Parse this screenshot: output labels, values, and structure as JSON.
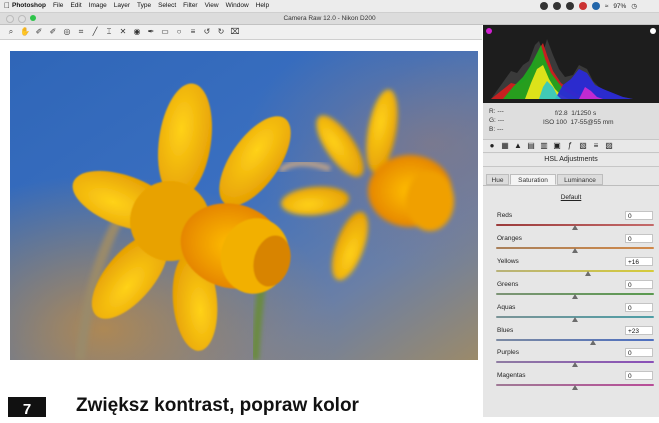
{
  "menubar": {
    "items": [
      "Photoshop",
      "File",
      "Edit",
      "Image",
      "Layer",
      "Type",
      "Select",
      "Filter",
      "View",
      "Window",
      "Help"
    ],
    "battery": "97%"
  },
  "window": {
    "title": "Camera Raw 12.0  -  Nikon D200"
  },
  "info": {
    "r_label": "R:",
    "g_label": "G:",
    "b_label": "B:",
    "r_value": "---",
    "g_value": "---",
    "b_value": "---",
    "aperture": "f/2.8",
    "shutter": "1/1250 s",
    "iso": "ISO 100",
    "lens": "17-55@55 mm"
  },
  "panel": {
    "title": "HSL Adjustments",
    "tabs": [
      "Hue",
      "Saturation",
      "Luminance"
    ],
    "active_tab": "Saturation",
    "default_link": "Default",
    "sliders": [
      {
        "label": "Reds",
        "value": "0",
        "level": 0.5,
        "colors": [
          "#9b3b3b",
          "#c46a6a"
        ]
      },
      {
        "label": "Oranges",
        "value": "0",
        "level": 0.5,
        "colors": [
          "#a9805a",
          "#d0894a"
        ]
      },
      {
        "label": "Yellows",
        "value": "+16",
        "level": 0.58,
        "colors": [
          "#b8b27a",
          "#d6cb3a"
        ]
      },
      {
        "label": "Greens",
        "value": "0",
        "level": 0.5,
        "colors": [
          "#7d9477",
          "#5a9a4f"
        ]
      },
      {
        "label": "Aquas",
        "value": "0",
        "level": 0.5,
        "colors": [
          "#7b9497",
          "#4e9ea6"
        ]
      },
      {
        "label": "Blues",
        "value": "+23",
        "level": 0.615,
        "colors": [
          "#7c8aa2",
          "#4d6fc0"
        ]
      },
      {
        "label": "Purples",
        "value": "0",
        "level": 0.5,
        "colors": [
          "#8f7ca2",
          "#8a4fb8"
        ]
      },
      {
        "label": "Magentas",
        "value": "0",
        "level": 0.5,
        "colors": [
          "#a07a96",
          "#b84d98"
        ]
      }
    ]
  },
  "footer": {
    "step": "7",
    "heading": "Zwiększ kontrast, popraw kolor"
  },
  "icons": {
    "tools": [
      "zoom-icon",
      "hand-icon",
      "white-balance-icon",
      "color-sampler-icon",
      "target-adjustment-icon",
      "crop-icon",
      "straighten-icon",
      "transform-icon",
      "spot-removal-icon",
      "red-eye-icon",
      "adjustment-brush-icon",
      "graduated-filter-icon",
      "radial-filter-icon",
      "preferences-icon",
      "rotate-ccw-icon",
      "rotate-cw-icon",
      "trash-icon"
    ],
    "panels": [
      "basic-icon",
      "tone-curve-icon",
      "detail-icon",
      "hsl-icon",
      "split-toning-icon",
      "lens-icon",
      "fx-icon",
      "calibration-icon",
      "presets-icon",
      "snapshots-icon"
    ]
  }
}
